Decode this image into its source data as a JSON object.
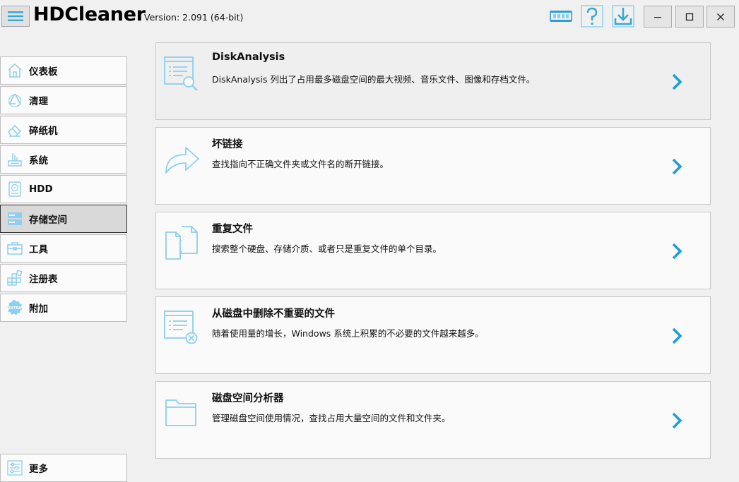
{
  "app": {
    "title": "HDCleaner",
    "version": "Version: 2.091 (64-bit)",
    "accent": "#1e9fd6",
    "icon_color": "#8ccfee"
  },
  "toolbar": {
    "icons": [
      "memory-icon",
      "help-icon",
      "download-icon"
    ]
  },
  "window": {
    "controls": [
      "minimize-icon",
      "maximize-icon",
      "close-icon"
    ]
  },
  "sidebar": {
    "items": [
      {
        "label": "仪表板",
        "icon": "home-icon"
      },
      {
        "label": "清理",
        "icon": "recycle-icon"
      },
      {
        "label": "碎纸机",
        "icon": "eraser-icon"
      },
      {
        "label": "系统",
        "icon": "system-icon"
      },
      {
        "label": "HDD",
        "icon": "hdd-icon"
      },
      {
        "label": "存储空间",
        "icon": "storage-icon",
        "active": true
      },
      {
        "label": "工具",
        "icon": "toolbox-icon"
      },
      {
        "label": "注册表",
        "icon": "registry-icon"
      },
      {
        "label": "附加",
        "icon": "extra-icon"
      }
    ],
    "more": {
      "label": "更多",
      "icon": "sliders-icon"
    }
  },
  "cards": [
    {
      "title": "DiskAnalysis",
      "desc": "DiskAnalysis 列出了占用最多磁盘空间的最大视频、音乐文件、图像和存档文件。",
      "icon": "disk-analysis-icon"
    },
    {
      "title": "坏链接",
      "desc": "查找指向不正确文件夹或文件名的断开链接。",
      "icon": "broken-link-icon"
    },
    {
      "title": "重复文件",
      "desc": "搜索整个硬盘、存储介质、或者只是重复文件的单个目录。",
      "icon": "duplicate-files-icon"
    },
    {
      "title": "从磁盘中删除不重要的文件",
      "desc": "随着使用量的增长，Windows 系统上积累的不必要的文件越来越多。",
      "icon": "delete-files-icon"
    },
    {
      "title": "磁盘空间分析器",
      "desc": "管理磁盘空间使用情况，查找占用大量空间的文件和文件夹。",
      "icon": "folder-icon"
    }
  ]
}
